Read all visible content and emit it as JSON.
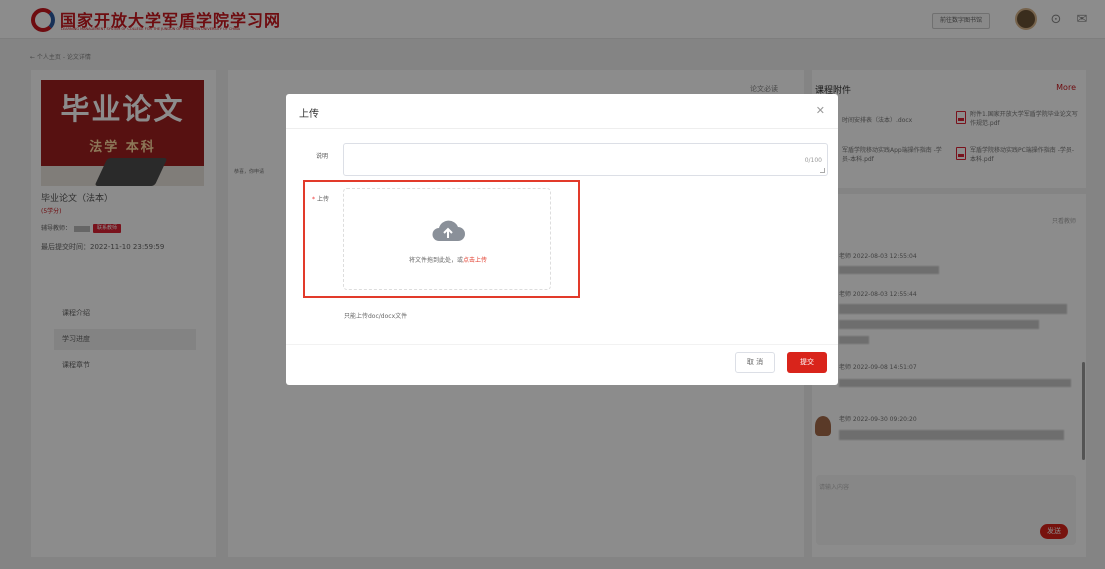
{
  "header": {
    "site_title": "国家开放大学军盾学院学习网",
    "site_subtitle": "LEARNING MANAGEMENT SYSTEM OF COLLEGE FOR THE JUNDUN OF THE OPEN UNIVERSITY OF CHINA",
    "library_button": "前往数字图书馆",
    "accent_color": "#c8171e"
  },
  "breadcrumb": "← 个人主页 - 论文详情",
  "course": {
    "cover_title": "毕业论文",
    "cover_subtitle": "法学 本科",
    "name": "毕业论文（法本）",
    "credits": "(5学分)",
    "tutor_label": "辅导教师：",
    "tutor_badge": "联系教师",
    "deadline": "最后提交时间：2022-11-10 23:59:59",
    "nav": [
      "课程介绍",
      "学习进度",
      "课程章节"
    ]
  },
  "main": {
    "label": "论文必读",
    "snippet": "恭喜，你申请"
  },
  "attachments": {
    "title": "课程附件",
    "more": "More",
    "items": [
      "时间安排表（法本）.docx",
      "附件1.国家开放大学军盾学院毕业论文写作规范.pdf",
      "军盾学院移动实践App端操作指南 -学员-本科.pdf",
      "军盾学院移动实践PC端操作指南 -学员-本科.pdf"
    ]
  },
  "discussion": {
    "view_tutor_only": "只看教师",
    "messages": [
      "老师 2022-08-03 12:55:04",
      "老师 2022-08-03 12:55:44",
      "老师 2022-09-08 14:51:07",
      "老师 2022-09-30 09:20:20"
    ],
    "input_placeholder": "请输入内容",
    "send": "发送"
  },
  "modal": {
    "title": "上传",
    "desc_label": "说明",
    "counter": "0/100",
    "upload_label": "上传",
    "drop_text": "将文件拖到此处，或",
    "drop_link": "点击上传",
    "hint": "只能上传doc/docx文件",
    "cancel": "取 消",
    "submit": "提交",
    "highlight_color": "#e23a2a"
  }
}
